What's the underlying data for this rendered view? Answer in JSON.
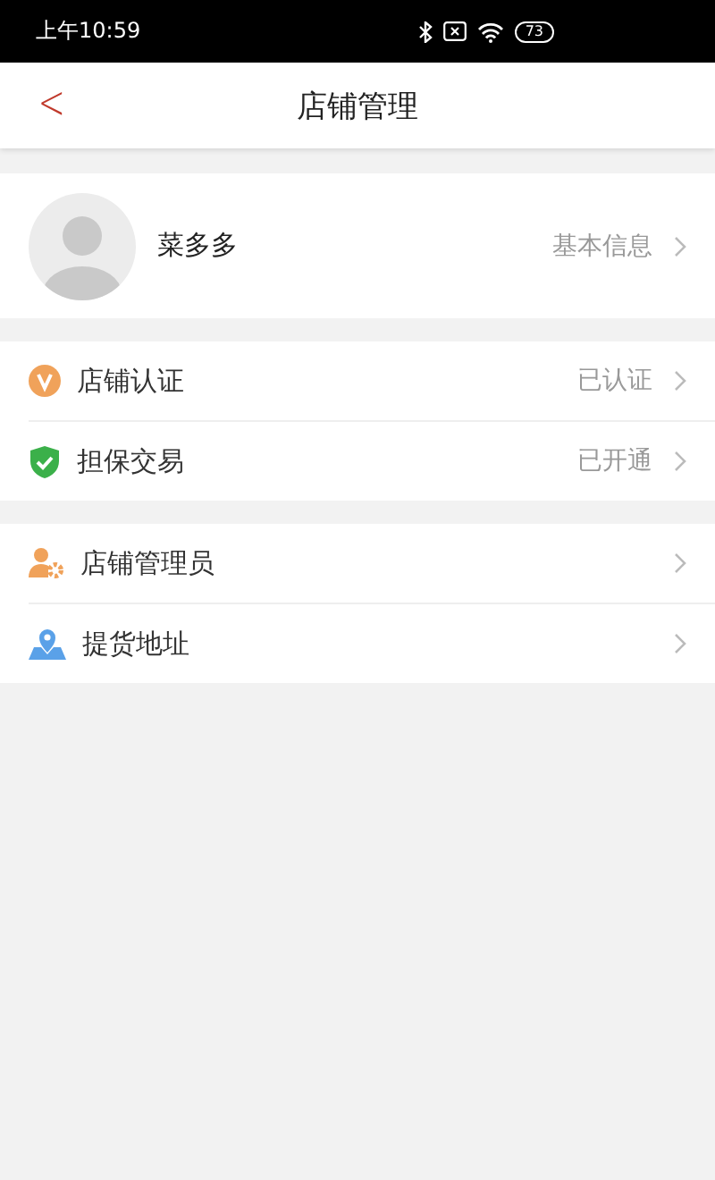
{
  "status_bar": {
    "time": "上午10:59",
    "battery": "73"
  },
  "header": {
    "back": "<",
    "title": "店铺管理"
  },
  "profile": {
    "name": "菜多多",
    "link": "基本信息"
  },
  "groups": [
    {
      "items": [
        {
          "kind": "verify",
          "label": "店铺认证",
          "value": "已认证"
        },
        {
          "kind": "shield",
          "label": "担保交易",
          "value": "已开通"
        }
      ]
    },
    {
      "items": [
        {
          "kind": "admin",
          "label": "店铺管理员"
        },
        {
          "kind": "location",
          "label": "提货地址"
        }
      ]
    }
  ]
}
